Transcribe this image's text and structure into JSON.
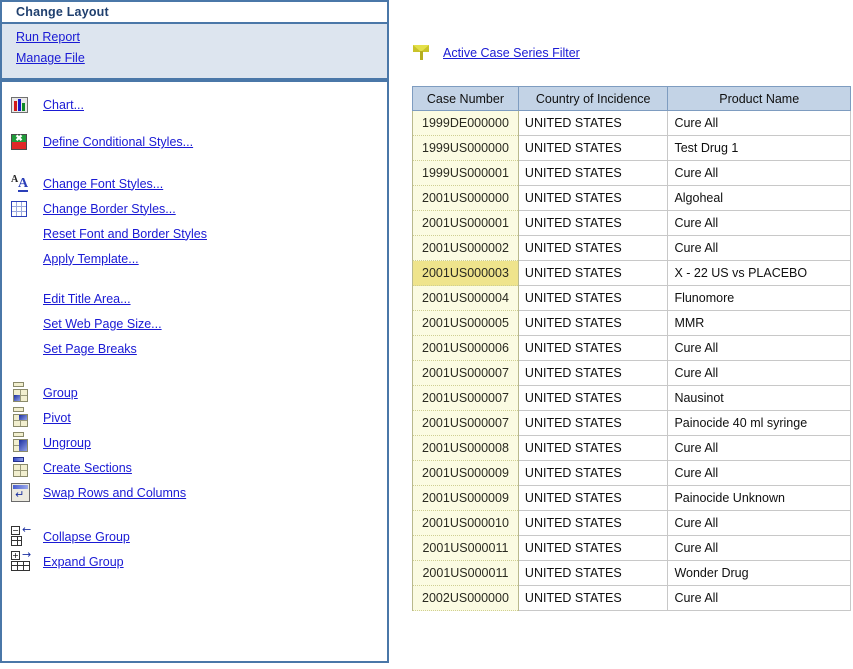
{
  "sidebar": {
    "title": "Change Layout",
    "actions": [
      {
        "label": "Run Report",
        "icon": "none"
      },
      {
        "label": "Manage File",
        "icon": "none"
      }
    ],
    "groups": [
      {
        "items": [
          {
            "label": "Chart...",
            "icon": "chart-icon"
          },
          {
            "label": "Define Conditional Styles...",
            "icon": "conditional-styles-icon"
          }
        ]
      },
      {
        "items": [
          {
            "label": "Change Font Styles...",
            "icon": "font-styles-icon"
          },
          {
            "label": "Change Border Styles...",
            "icon": "border-styles-icon"
          },
          {
            "label": "Reset Font and Border Styles",
            "icon": "none"
          },
          {
            "label": "Apply Template...",
            "icon": "none"
          }
        ]
      },
      {
        "items": [
          {
            "label": "Edit Title Area...",
            "icon": "none"
          },
          {
            "label": "Set Web Page Size...",
            "icon": "none"
          },
          {
            "label": "Set Page Breaks",
            "icon": "none"
          }
        ]
      },
      {
        "items": [
          {
            "label": "Group",
            "icon": "group-icon"
          },
          {
            "label": "Pivot",
            "icon": "pivot-icon"
          },
          {
            "label": "Ungroup",
            "icon": "ungroup-icon"
          },
          {
            "label": "Create Sections",
            "icon": "create-sections-icon"
          },
          {
            "label": "Swap Rows and Columns",
            "icon": "swap-rows-columns-icon"
          }
        ]
      },
      {
        "items": [
          {
            "label": "Collapse Group",
            "icon": "collapse-group-icon"
          },
          {
            "label": "Expand Group",
            "icon": "expand-group-icon"
          }
        ]
      }
    ]
  },
  "filter": {
    "icon": "funnel-icon",
    "label": "Active Case Series Filter"
  },
  "table": {
    "columns": [
      "Case Number",
      "Country of Incidence",
      "Product Name"
    ],
    "selected_row_index": 6,
    "rows": [
      {
        "case_number": "1999DE000000",
        "country": "UNITED STATES",
        "product": "Cure All"
      },
      {
        "case_number": "1999US000000",
        "country": "UNITED STATES",
        "product": "Test Drug 1"
      },
      {
        "case_number": "1999US000001",
        "country": "UNITED STATES",
        "product": "Cure All"
      },
      {
        "case_number": "2001US000000",
        "country": "UNITED STATES",
        "product": "Algoheal"
      },
      {
        "case_number": "2001US000001",
        "country": "UNITED STATES",
        "product": "Cure All"
      },
      {
        "case_number": "2001US000002",
        "country": "UNITED STATES",
        "product": "Cure All"
      },
      {
        "case_number": "2001US000003",
        "country": "UNITED STATES",
        "product": "X - 22 US vs PLACEBO"
      },
      {
        "case_number": "2001US000004",
        "country": "UNITED STATES",
        "product": "Flunomore"
      },
      {
        "case_number": "2001US000005",
        "country": "UNITED STATES",
        "product": "MMR"
      },
      {
        "case_number": "2001US000006",
        "country": "UNITED STATES",
        "product": "Cure All"
      },
      {
        "case_number": "2001US000007",
        "country": "UNITED STATES",
        "product": "Cure All"
      },
      {
        "case_number": "2001US000007",
        "country": "UNITED STATES",
        "product": "Nausinot"
      },
      {
        "case_number": "2001US000007",
        "country": "UNITED STATES",
        "product": "Painocide  40 ml syringe"
      },
      {
        "case_number": "2001US000008",
        "country": "UNITED STATES",
        "product": "Cure All"
      },
      {
        "case_number": "2001US000009",
        "country": "UNITED STATES",
        "product": "Cure All"
      },
      {
        "case_number": "2001US000009",
        "country": "UNITED STATES",
        "product": "Painocide Unknown"
      },
      {
        "case_number": "2001US000010",
        "country": "UNITED STATES",
        "product": "Cure All"
      },
      {
        "case_number": "2001US000011",
        "country": "UNITED STATES",
        "product": "Cure All"
      },
      {
        "case_number": "2001US000011",
        "country": "UNITED STATES",
        "product": "Wonder Drug"
      },
      {
        "case_number": "2002US000000",
        "country": "UNITED STATES",
        "product": "Cure All"
      }
    ]
  },
  "colors": {
    "panel_border": "#4a77a8",
    "title_text": "#1f3f6e",
    "link": "#1a1ad4",
    "actions_bg": "#dde5ef",
    "header_bg": "#c3d3e6",
    "case_cell_bg": "#fbfbe2",
    "selected_case_bg": "#efe48c"
  }
}
